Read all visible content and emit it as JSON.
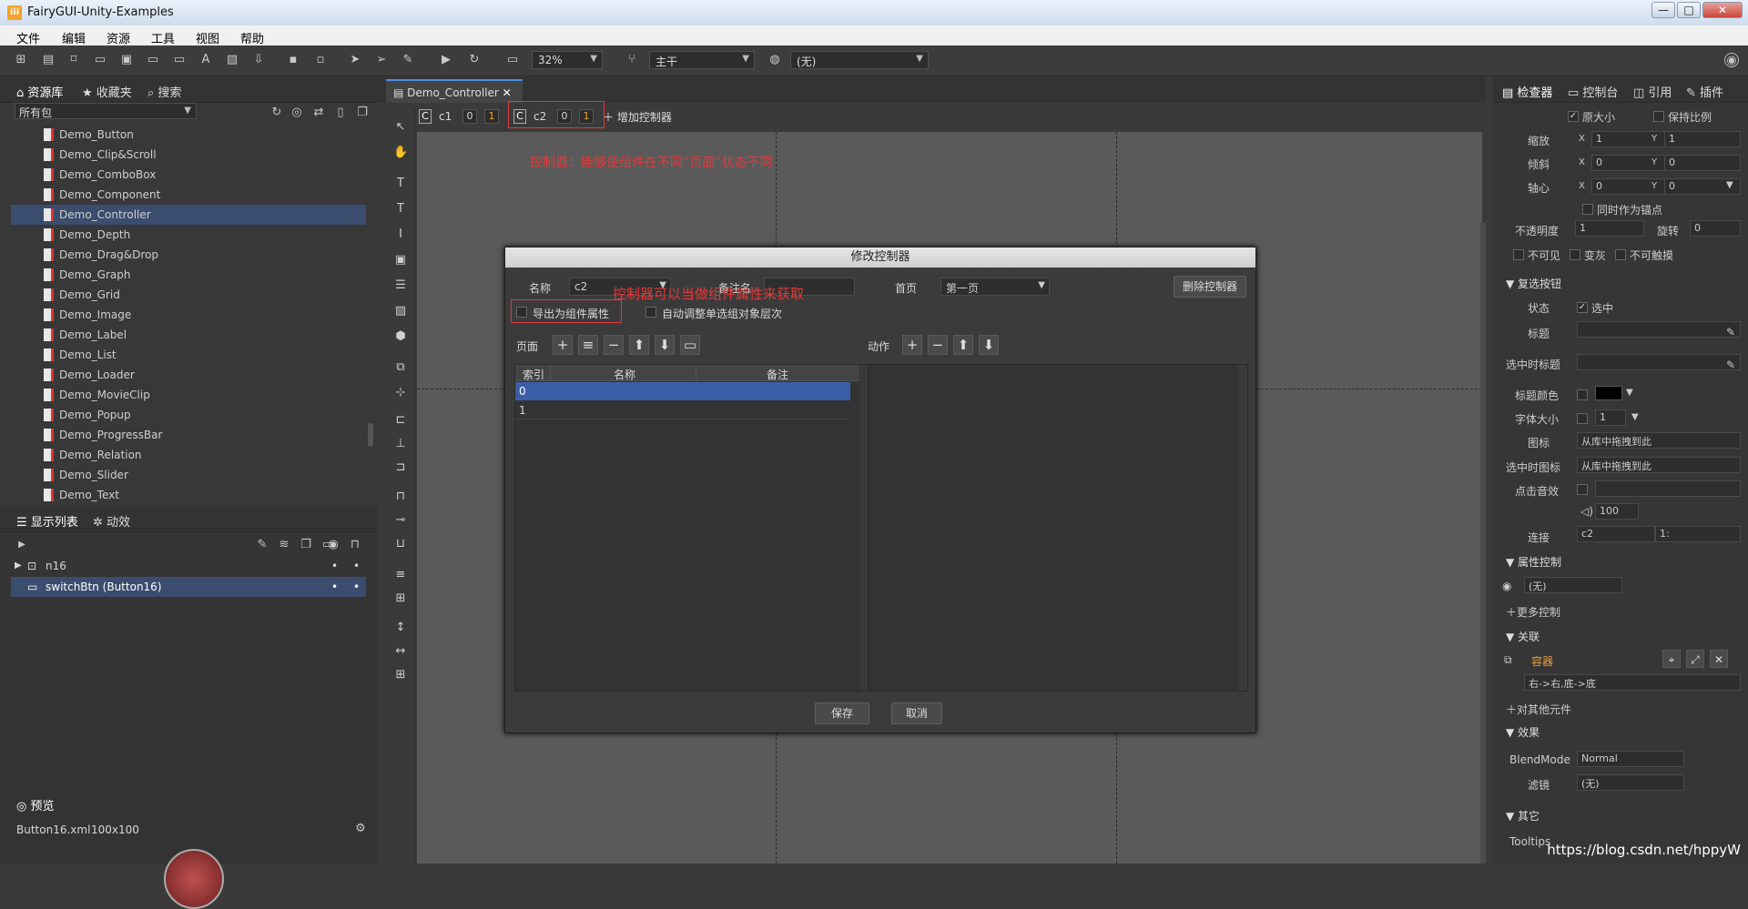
{
  "window": {
    "title": "FairyGUI-Unity-Examples",
    "icon_text": "iii"
  },
  "menu": [
    "文件",
    "编辑",
    "资源",
    "工具",
    "视图",
    "帮助"
  ],
  "toolbar": {
    "zoom": "32%",
    "branch": "主干",
    "lang": "(无)"
  },
  "library": {
    "tabs": [
      "资源库",
      "收藏夹",
      "搜索"
    ],
    "package": "所有包",
    "items": [
      "Demo_Button",
      "Demo_Clip&Scroll",
      "Demo_ComboBox",
      "Demo_Component",
      "Demo_Controller",
      "Demo_Depth",
      "Demo_Drag&Drop",
      "Demo_Graph",
      "Demo_Grid",
      "Demo_Image",
      "Demo_Label",
      "Demo_List",
      "Demo_Loader",
      "Demo_MovieClip",
      "Demo_Popup",
      "Demo_ProgressBar",
      "Demo_Relation",
      "Demo_Slider",
      "Demo_Text"
    ],
    "selected": "Demo_Controller"
  },
  "display": {
    "tabs": [
      "显示列表",
      "动效"
    ],
    "items": [
      "n16",
      "switchBtn (Button16)"
    ]
  },
  "preview": {
    "tab": "预览",
    "file": "Button16.xml",
    "size": "100x100"
  },
  "doc": {
    "tab": "Demo_Controller",
    "controllers": [
      {
        "name": "c1",
        "p0": "0",
        "p1": "1"
      },
      {
        "name": "c2",
        "p0": "0",
        "p1": "1"
      }
    ],
    "add": "增加控制器"
  },
  "annotations": {
    "a1": "控制器：能够使组件在不同“页面”状态不同",
    "a2": "控制器可以当做组件属性来获取"
  },
  "dialog": {
    "title": "修改控制器",
    "name_label": "名称",
    "name_value": "c2",
    "remark_label": "备注名",
    "home_label": "首页",
    "home_value": "第一页",
    "delete_btn": "删除控制器",
    "export_label": "导出为组件属性",
    "auto_label": "自动调整单选组对象层次",
    "pages_label": "页面",
    "actions_label": "动作",
    "cols": [
      "索引",
      "名称",
      "备注"
    ],
    "rows": [
      "0",
      "1"
    ],
    "save": "保存",
    "cancel": "取消"
  },
  "inspector": {
    "tabs": [
      "检查器",
      "控制台",
      "引用",
      "插件"
    ],
    "orig_size": "原大小",
    "keep_ratio": "保持比例",
    "scale": "缩放",
    "skew": "倾斜",
    "pivot": "轴心",
    "sx": "1",
    "sy": "1",
    "kx": "0",
    "ky": "0",
    "px": "0",
    "py": "0",
    "anchor": "同时作为锚点",
    "alpha_label": "不透明度",
    "alpha": "1",
    "rot_label": "旋转",
    "rot": "0",
    "invisible": "不可见",
    "gray": "变灰",
    "untouch": "不可触摸",
    "sec1": "复选按钮",
    "state": "状态",
    "state_val": "选中",
    "title": "标题",
    "sel_title": "选中时标题",
    "title_color": "标题颜色",
    "font_size": "字体大小",
    "fs_val": "1",
    "icon": "图标",
    "icon_ph": "从库中拖拽到此",
    "sel_icon": "选中时图标",
    "sound": "点击音效",
    "vol": "100",
    "link": "连接",
    "link1": "c2",
    "link2": "1:",
    "sec2": "属性控制",
    "prop_val": "(无)",
    "more": "更多控制",
    "sec3": "关联",
    "container": "容器",
    "rel_val": "右->右,底->底",
    "other": "对其他元件",
    "sec4": "效果",
    "blend_label": "BlendMode",
    "blend": "Normal",
    "filter_label": "滤镜",
    "filter": "(无)",
    "sec5": "其它",
    "tooltips": "Tooltips",
    "x_lbl": "X",
    "y_lbl": "Y"
  },
  "watermark": "https://blog.csdn.net/hppyW"
}
